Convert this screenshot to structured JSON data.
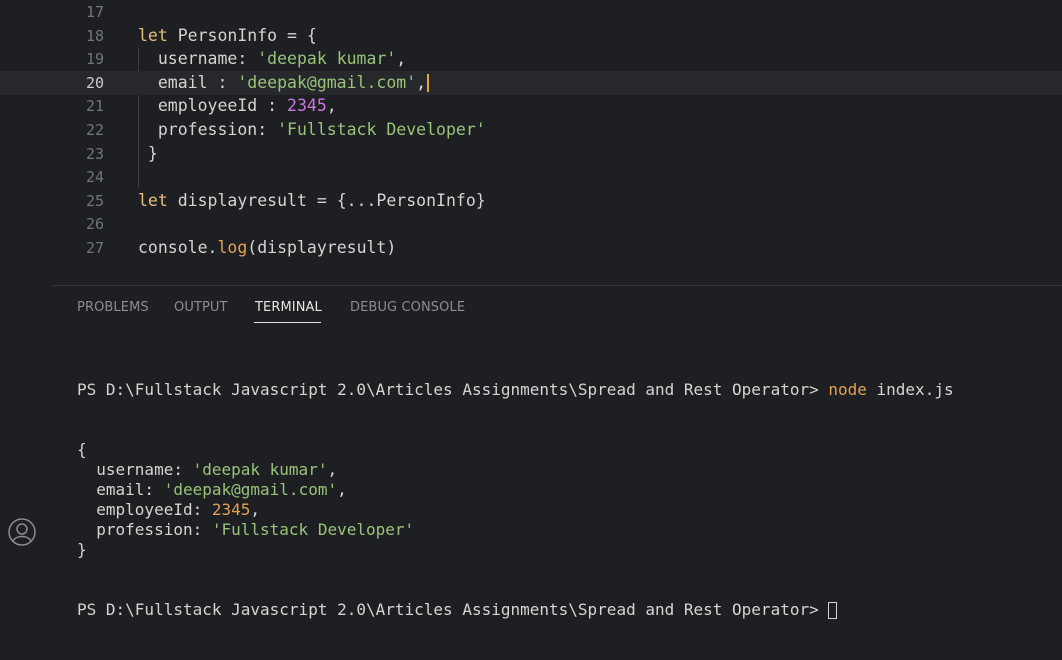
{
  "editor": {
    "lines": [
      {
        "num": "17",
        "parts": []
      },
      {
        "num": "18",
        "parts": [
          {
            "t": "let",
            "c": "kw"
          },
          {
            "t": " PersonInfo = {",
            "c": "plain"
          }
        ]
      },
      {
        "num": "19",
        "parts": [
          {
            "t": "  username: ",
            "c": "plain"
          },
          {
            "t": "'deepak kumar'",
            "c": "str"
          },
          {
            "t": ",",
            "c": "plain"
          }
        ]
      },
      {
        "num": "20",
        "current": true,
        "parts": [
          {
            "t": "  email : ",
            "c": "plain"
          },
          {
            "t": "'deepak@gmail.com'",
            "c": "str"
          },
          {
            "t": ",",
            "c": "plain"
          }
        ]
      },
      {
        "num": "21",
        "parts": [
          {
            "t": "  employeeId : ",
            "c": "plain"
          },
          {
            "t": "2345",
            "c": "num"
          },
          {
            "t": ",",
            "c": "plain"
          }
        ]
      },
      {
        "num": "22",
        "parts": [
          {
            "t": "  profession: ",
            "c": "plain"
          },
          {
            "t": "'Fullstack Developer'",
            "c": "str"
          }
        ]
      },
      {
        "num": "23",
        "parts": [
          {
            "t": " }",
            "c": "plain"
          }
        ]
      },
      {
        "num": "24",
        "parts": []
      },
      {
        "num": "25",
        "parts": [
          {
            "t": "let",
            "c": "kw"
          },
          {
            "t": " displayresult = {...PersonInfo}",
            "c": "plain"
          }
        ]
      },
      {
        "num": "26",
        "parts": []
      },
      {
        "num": "27",
        "parts": [
          {
            "t": "console.",
            "c": "plain"
          },
          {
            "t": "log",
            "c": "fn"
          },
          {
            "t": "(displayresult)",
            "c": "plain"
          }
        ]
      }
    ]
  },
  "panel": {
    "tabs": {
      "problems": "PROBLEMS",
      "output": "OUTPUT",
      "terminal": "TERMINAL",
      "debug": "DEBUG CONSOLE"
    },
    "active_tab": "TERMINAL"
  },
  "terminal": {
    "prompt": "PS D:\\Fullstack Javascript 2.0\\Articles Assignments\\Spread and Rest Operator> ",
    "command_name": "node",
    "command_args": " index.js",
    "output": [
      [
        {
          "t": "{",
          "c": "plain"
        }
      ],
      [
        {
          "t": "  username: ",
          "c": "plain"
        },
        {
          "t": "'deepak kumar'",
          "c": "t-str"
        },
        {
          "t": ",",
          "c": "plain"
        }
      ],
      [
        {
          "t": "  email: ",
          "c": "plain"
        },
        {
          "t": "'deepak@gmail.com'",
          "c": "t-str"
        },
        {
          "t": ",",
          "c": "plain"
        }
      ],
      [
        {
          "t": "  employeeId: ",
          "c": "plain"
        },
        {
          "t": "2345",
          "c": "t-num"
        },
        {
          "t": ",",
          "c": "plain"
        }
      ],
      [
        {
          "t": "  profession: ",
          "c": "plain"
        },
        {
          "t": "'Fullstack Developer'",
          "c": "t-str"
        }
      ],
      [
        {
          "t": "}",
          "c": "plain"
        }
      ]
    ]
  },
  "colors": {
    "background": "#1e1f22",
    "keyword": "#e5c07b",
    "string": "#98c379",
    "number": "#c678dd",
    "function": "#e5a150"
  },
  "icons": {
    "account": "account-icon"
  }
}
